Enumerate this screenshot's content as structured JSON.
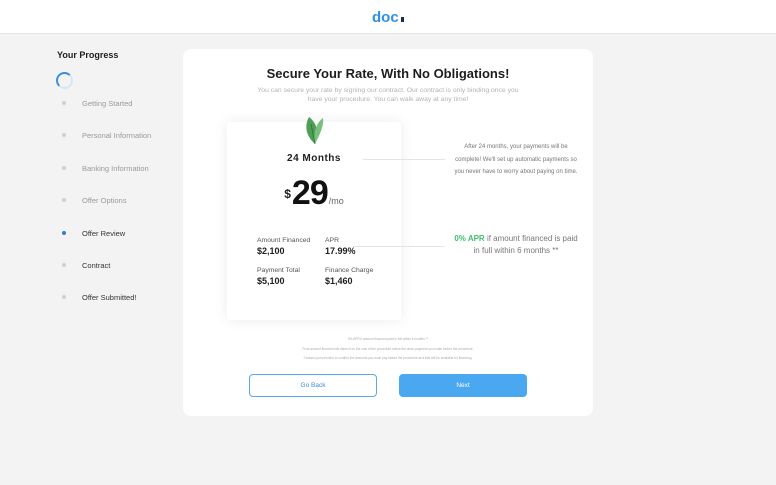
{
  "logo": {
    "text": "doc"
  },
  "sidebar": {
    "title": "Your Progress",
    "steps": [
      {
        "label": "Getting Started"
      },
      {
        "label": "Personal Information"
      },
      {
        "label": "Banking Information"
      },
      {
        "label": "Offer Options"
      },
      {
        "label": "Offer Review"
      },
      {
        "label": "Contract"
      },
      {
        "label": "Offer Submitted!"
      }
    ]
  },
  "main": {
    "headline": "Secure Your Rate, With No Obligations!",
    "subline": "You can secure your rate by signing our contract. Our contract is only binding once you have your procedure. You can walk away at any time!",
    "offer": {
      "term": "24 Months",
      "currency": "$",
      "amount": "29",
      "per": "/mo",
      "amount_financed_label": "Amount Financed",
      "amount_financed_value": "$2,100",
      "apr_label": "APR",
      "apr_value": "17.99%",
      "payment_total_label": "Payment Total",
      "payment_total_value": "$5,100",
      "finance_charge_label": "Finance Charge",
      "finance_charge_value": "$1,460"
    },
    "note_payments": "After 24 months, your payments will be complete! We'll set up automatic payments so you never have to worry about paying on time.",
    "note_apr_highlight": "0% APR",
    "note_apr_rest": " if amount financed is paid in full within 6 months **",
    "fine_print": [
      "0% APR if amount financed paid in full within 6 months **",
      "Final amount financed will depend on the cost of the procedure minus the down payment you make before the procedure.",
      "Contact your provider to confirm the amounts you must pay before the procedure and that will be available for financing."
    ],
    "back_label": "Go Back",
    "next_label": "Next"
  },
  "colors": {
    "accent": "#4aa8f0",
    "apr_green": "#3fbf6a",
    "active_dot": "#2d7fd6"
  }
}
